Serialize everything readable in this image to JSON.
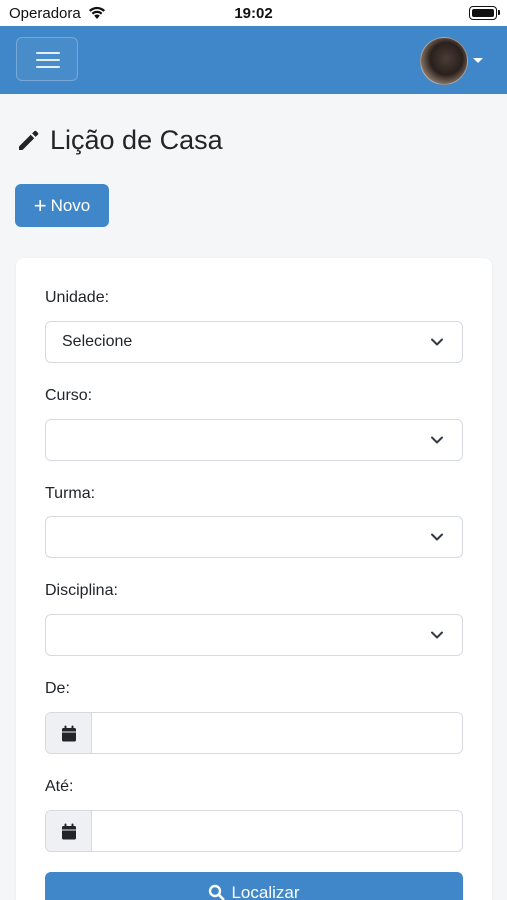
{
  "status_bar": {
    "carrier": "Operadora",
    "time": "19:02"
  },
  "navbar": {
    "menu_icon": "hamburger-icon",
    "avatar_caret_icon": "caret-down-icon"
  },
  "page": {
    "title": "Lição de Casa",
    "title_icon": "pencil-icon",
    "new_button": "Novo",
    "new_button_icon": "plus-icon"
  },
  "form": {
    "unidade": {
      "label": "Unidade:",
      "value": "Selecione"
    },
    "curso": {
      "label": "Curso:",
      "value": ""
    },
    "turma": {
      "label": "Turma:",
      "value": ""
    },
    "disciplina": {
      "label": "Disciplina:",
      "value": ""
    },
    "de": {
      "label": "De:",
      "value": ""
    },
    "ate": {
      "label": "Até:",
      "value": ""
    },
    "search_button": "Localizar",
    "search_icon": "search-icon",
    "calendar_icon": "calendar-icon"
  },
  "colors": {
    "primary": "#3f87c8",
    "background": "#f5f6f8",
    "card": "#ffffff"
  }
}
